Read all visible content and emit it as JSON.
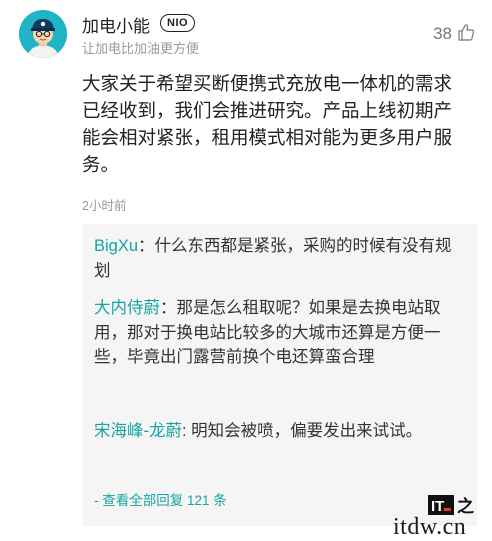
{
  "comment": {
    "username": "加电小能",
    "badge": "NIO",
    "subtitle": "让加电比加油更方便",
    "likes": "38",
    "content": "大家关于希望买断便携式充放电一体机的需求已经收到，我们会推进研究。产品上线初期产能会相对紧张，租用模式相对能为更多用户服务。",
    "time": "2小时前"
  },
  "replies": [
    {
      "name": "BigXu",
      "sep": "：",
      "text": "什么东西都是紧张，采购的时候有没有规划"
    },
    {
      "name": "大内侍蔚",
      "sep": "：",
      "text": "那是怎么租取呢？如果是去换电站取用，那对于换电站比较多的大城市还算是方便一些，毕竟出门露营前换个电还算蛮合理"
    },
    {
      "name": "宋海峰-龙蔚",
      "sep": ": ",
      "text": "明知会被喷，偏要发出来试试。"
    }
  ],
  "view_all": "- 查看全部回复 121 条",
  "watermark": {
    "logo": "IT之家",
    "text": "itdw.cn"
  },
  "colors": {
    "accent": "#16a3a3",
    "avatar_bg": "#1fb5c6",
    "reply_bg": "#f5f5f5"
  }
}
